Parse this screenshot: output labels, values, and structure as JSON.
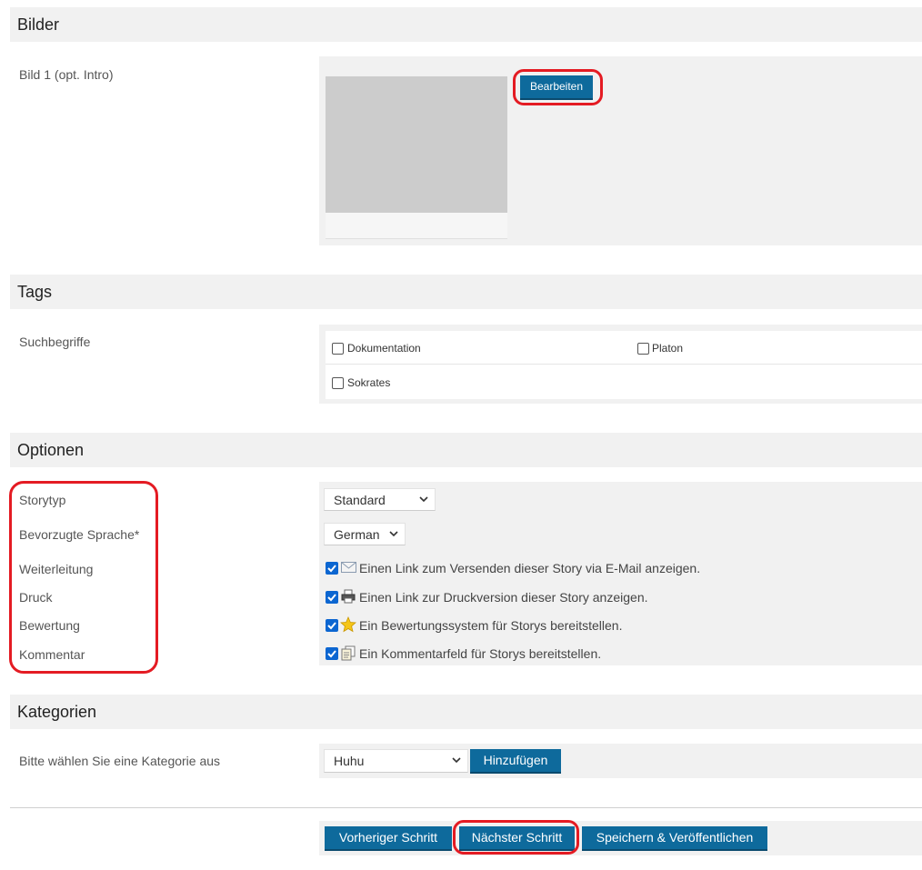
{
  "sections": {
    "bilder": {
      "title": "Bilder"
    },
    "tags": {
      "title": "Tags"
    },
    "optionen": {
      "title": "Optionen"
    },
    "kategorien": {
      "title": "Kategorien"
    }
  },
  "bilder": {
    "image_label": "Bild 1 (opt. Intro)",
    "edit_button": "Bearbeiten"
  },
  "tags": {
    "label": "Suchbegriffe",
    "items": [
      {
        "label": "Dokumentation",
        "checked": false
      },
      {
        "label": "Platon",
        "checked": false
      },
      {
        "label": "Sokrates",
        "checked": false
      }
    ]
  },
  "options": {
    "storytyp": {
      "label": "Storytyp",
      "value": "Standard"
    },
    "sprache": {
      "label": "Bevorzugte Sprache*",
      "value": "German"
    },
    "weiterleitung": {
      "label": "Weiterleitung",
      "text": "Einen Link zum Versenden dieser Story via E-Mail anzeigen.",
      "checked": true,
      "icon": "envelope-icon"
    },
    "druck": {
      "label": "Druck",
      "text": "Einen Link zur Druckversion dieser Story anzeigen.",
      "checked": true,
      "icon": "printer-icon"
    },
    "bewertung": {
      "label": "Bewertung",
      "text": "Ein Bewertungssystem für Storys bereitstellen.",
      "checked": true,
      "icon": "star-icon"
    },
    "kommentar": {
      "label": "Kommentar",
      "text": "Ein Kommentarfeld für Storys bereitstellen.",
      "checked": true,
      "icon": "comment-icon"
    }
  },
  "kategorien": {
    "label": "Bitte wählen Sie eine Kategorie aus",
    "value": "Huhu",
    "add_button": "Hinzufügen"
  },
  "footer": {
    "prev": "Vorheriger Schritt",
    "next": "Nächster Schritt",
    "save": "Speichern & Veröffentlichen"
  },
  "colors": {
    "button": "#0e6a9c",
    "highlight": "#e41b23",
    "checkbox": "#0c66d1",
    "panel": "#f1f1f1"
  }
}
